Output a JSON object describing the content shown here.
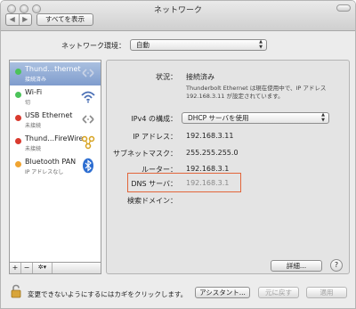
{
  "window": {
    "title": "ネットワーク"
  },
  "toolbar": {
    "back": "◀",
    "forward": "▶",
    "show_all": "すべてを表示"
  },
  "location": {
    "label": "ネットワーク環境：",
    "value": "自動"
  },
  "services": [
    {
      "name": "Thund…thernet",
      "status": "接続済み",
      "color": "#4cc35a",
      "icon": "ethernet-icon",
      "selected": true
    },
    {
      "name": "Wi-Fi",
      "status": "切",
      "color": "#4cc35a",
      "icon": "wifi-icon",
      "selected": false
    },
    {
      "name": "USB Ethernet",
      "status": "未接続",
      "color": "#d93a2e",
      "icon": "ethernet-icon",
      "selected": false
    },
    {
      "name": "Thund…FireWire",
      "status": "未接続",
      "color": "#d93a2e",
      "icon": "firewire-icon",
      "selected": false
    },
    {
      "name": "Bluetooth PAN",
      "status": "IP アドレスなし",
      "color": "#f0a431",
      "icon": "bluetooth-icon",
      "selected": false
    }
  ],
  "sidebar_tools": {
    "add": "+",
    "remove": "−",
    "gear": "✲▾"
  },
  "detail": {
    "status_label": "状況：",
    "status_value": "接続済み",
    "status_desc": "Thunderbolt Ethernet は現在使用中で、IP アドレス 192.168.3.11 が設定されています。",
    "ipv4_label": "IPv4 の構成：",
    "ipv4_value": "DHCP サーバを使用",
    "ip_label": "IP アドレス：",
    "ip_value": "192.168.3.11",
    "mask_label": "サブネットマスク：",
    "mask_value": "255.255.255.0",
    "router_label": "ルーター：",
    "router_value": "192.168.3.1",
    "dns_label": "DNS サーバ：",
    "dns_value": "192.168.3.1",
    "search_label": "検索ドメイン：",
    "advanced": "詳細...",
    "help": "?"
  },
  "footer": {
    "lock_text": "変更できないようにするにはカギをクリックします。",
    "assistant": "アシスタント...",
    "revert": "元に戻す",
    "apply": "適用"
  },
  "colors": {
    "highlight": "#e2653a",
    "selection": "#7f9ccd"
  }
}
